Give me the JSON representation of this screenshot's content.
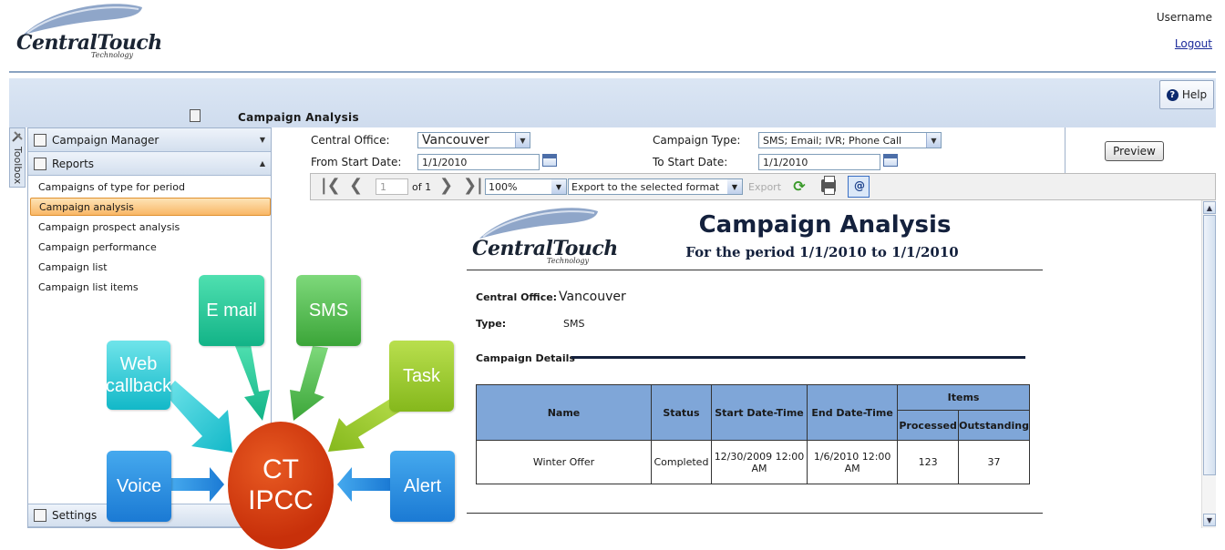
{
  "header": {
    "logo_brand": "CentralTouch",
    "logo_sub": "Technology",
    "username": "Username",
    "logout": "Logout"
  },
  "titlebar": {
    "help": "Help",
    "page_title": "Campaign Analysis"
  },
  "toolbox": {
    "label": "Toolbox"
  },
  "sidebar": {
    "sections": [
      {
        "label": "Campaign Manager"
      },
      {
        "label": "Reports"
      }
    ],
    "items": [
      {
        "label": "Campaigns of type for period"
      },
      {
        "label": "Campaign analysis",
        "selected": true
      },
      {
        "label": "Campaign prospect analysis"
      },
      {
        "label": "Campaign performance"
      },
      {
        "label": "Campaign list"
      },
      {
        "label": "Campaign list items"
      }
    ],
    "settings": "Settings"
  },
  "filters": {
    "central_office_label": "Central Office:",
    "central_office_value": "Vancouver",
    "from_start_label": "From Start Date:",
    "from_start_value": "1/1/2010",
    "campaign_type_label": "Campaign Type:",
    "campaign_type_value": "SMS; Email; IVR; Phone Call",
    "to_start_label": "To  Start Date:",
    "to_start_value": "1/1/2010",
    "preview": "Preview"
  },
  "report_toolbar": {
    "page_number": "1",
    "page_of": "of 1",
    "zoom": "100%",
    "export_format": "Export to the selected format",
    "export": "Export"
  },
  "report": {
    "title": "Campaign Analysis",
    "period": "For the period 1/1/2010 to 1/1/2010",
    "central_office_label": "Central Office:",
    "central_office_value": "Vancouver",
    "type_label": "Type:",
    "type_value": "SMS",
    "details_label": "Campaign Details",
    "table": {
      "headers": {
        "name": "Name",
        "status": "Status",
        "start": "Start Date-Time",
        "end": "End Date-Time",
        "items": "Items",
        "processed": "Processed",
        "outstanding": "Outstanding"
      },
      "rows": [
        {
          "name": "Winter Offer",
          "status": "Completed",
          "start": "12/30/2009 12:00 AM",
          "end": "1/6/2010 12:00 AM",
          "processed": "123",
          "outstanding": "37"
        }
      ]
    }
  },
  "diagram": {
    "center_line1": "CT",
    "center_line2": "IPCC",
    "web_callback": "Web callback",
    "email": "E mail",
    "sms": "SMS",
    "task": "Task",
    "voice": "Voice",
    "alert": "Alert"
  },
  "colors": {
    "report_navy": "#14213d",
    "table_header": "#7fa6d8",
    "selected_item": "#f9b766",
    "center_circle": "#c8300a"
  }
}
